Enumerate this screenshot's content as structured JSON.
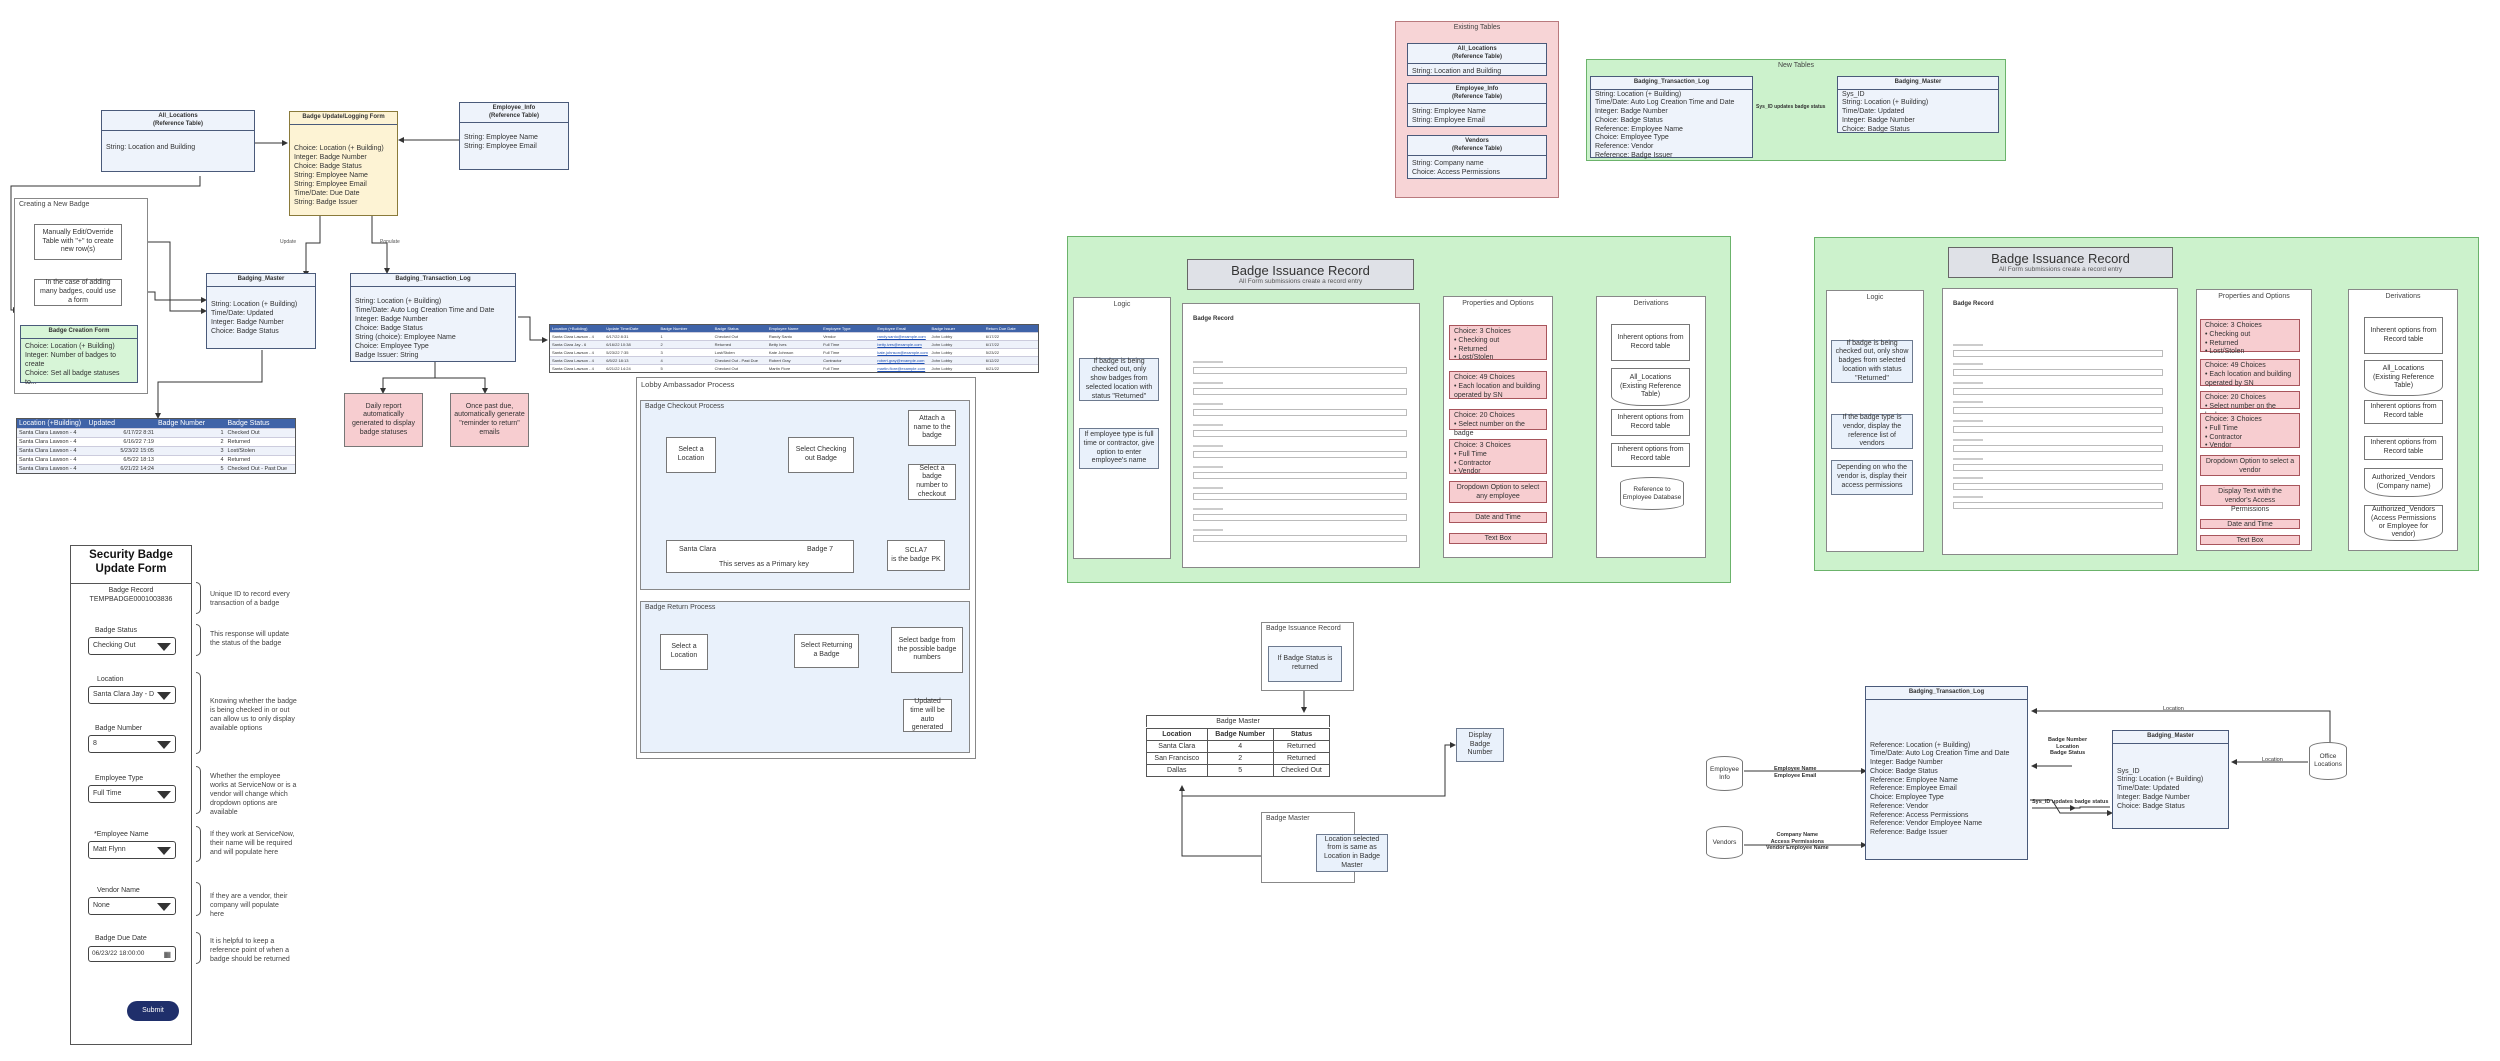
{
  "top_left": {
    "all_locations_title": "All_Locations\n(Reference Table)",
    "all_locations_body": "String: Location and Building",
    "badge_form_title": "Badge Update/Logging Form",
    "badge_form_body": "Choice: Location (+ Building)\nInteger: Badge Number\nChoice: Badge Status\nString: Employee Name\nString: Employee Email\nTime/Date: Due Date\nString: Badge Issuer",
    "employee_info_title": "Employee_Info\n(Reference Table)",
    "employee_info_body": "String: Employee Name\nString: Employee Email",
    "creating_group": "Creating a New Badge",
    "manual_edit": "Manually Edit/Override Table with \"+\" to create new row(s)",
    "case_adding": "In the case of adding many badges, could use a form",
    "creation_form_title": "Badge Creation Form",
    "creation_form_body": "Choice: Location (+ Building)\nInteger: Number of badges to create\nChoice: Set all badge statuses to...",
    "badging_master_title": "Badging_Master",
    "badging_master_body": "String: Location (+ Building)\nTime/Date: Updated\nInteger: Badge Number\nChoice: Badge Status",
    "transaction_log_title": "Badging_Transaction_Log",
    "transaction_log_body": "String: Location (+ Building)\nTime/Date: Auto Log Creation Time and Date\nInteger: Badge Number\nChoice: Badge Status\nString (choice): Employee Name\nChoice: Employee Type\nBadge Issuer: String",
    "edge_update": "Update",
    "edge_populate": "Populate",
    "daily_report": "Daily report automatically generated to display badge statuses",
    "once_past_due": "Once past due, automatically generate \"reminder to return\" emails"
  },
  "master_sheet": {
    "headers": [
      "Location (+Building)",
      "Updated",
      "Badge Number",
      "Badge Status"
    ],
    "rows": [
      [
        "Santa Clara Lawson - 4",
        "6/17/22 8:31",
        "1",
        "Checked Out"
      ],
      [
        "Santa Clara Lawson - 4",
        "6/16/22 7:19",
        "2",
        "Returned"
      ],
      [
        "Santa Clara Lawson - 4",
        "5/23/22 15:05",
        "3",
        "Lost/Stolen"
      ],
      [
        "Santa Clara Lawson - 4",
        "6/5/22 18:13",
        "4",
        "Returned"
      ],
      [
        "Santa Clara Lawson - 4",
        "6/21/22 14:24",
        "5",
        "Checked Out - Past Due"
      ]
    ]
  },
  "log_sheet": {
    "headers": [
      "Location (+Building)",
      "Update Time/Date",
      "Badge Number",
      "Badge Status",
      "Employee Name",
      "Employee Type",
      "Employee Email",
      "Badge Issuer",
      "Return Due Date"
    ],
    "rows": [
      [
        "Santa Clara Lawson - 4",
        "6/17/22 8:31",
        "1",
        "Checked Out",
        "Randy Santo",
        "Vendor",
        "randy.santo@example.com",
        "John Lobby",
        "6/17/22"
      ],
      [
        "Santa Clara Jay - 6",
        "6/16/22 10:38",
        "2",
        "Returned",
        "Betty Ives",
        "Full Time",
        "betty.ives@example.com",
        "John Lobby",
        "6/17/22"
      ],
      [
        "Santa Clara Lawson - 4",
        "5/23/22 7:35",
        "3",
        "Lost/Stolen",
        "Kate Johnson",
        "Full Time",
        "kate.johnson@example.com",
        "John Lobby",
        "5/23/22"
      ],
      [
        "Santa Clara Lawson - 4",
        "6/5/22 18:13",
        "4",
        "Checked Out - Past Due",
        "Robert Gray",
        "Contractor",
        "robert.gray@example.com",
        "John Lobby",
        "6/12/22"
      ],
      [
        "Santa Clara Lawson - 4",
        "6/21/22 14:24",
        "5",
        "Checked Out",
        "Martin Fiore",
        "Full Time",
        "martin.fiore@example.com",
        "John Lobby",
        "6/21/22"
      ]
    ]
  },
  "security_form": {
    "title": "Security Badge\nUpdate Form",
    "badge_record_label": "Badge Record",
    "badge_record_value": "TEMPBADGE0001003836",
    "badge_status_label": "Badge Status",
    "badge_status_value": "Checking Out",
    "location_label": "Location",
    "location_value": "Santa Clara Jay - D",
    "badge_number_label": "Badge Number",
    "badge_number_value": "8",
    "employee_type_label": "Employee Type",
    "employee_type_value": "Full Time",
    "employee_name_label": "*Employee Name",
    "employee_name_value": "Matt Flynn",
    "vendor_name_label": "Vendor Name",
    "vendor_name_value": "None",
    "due_date_label": "Badge Due Date",
    "due_date_value": "06/23/22 18:00:00",
    "submit_label": "Submit",
    "notes": [
      "Unique ID to record every transaction of a badge",
      "This response will update the status of the badge",
      "Knowing whether the badge is being checked in or out can allow us to only display available options",
      "Whether the employee works at ServiceNow or is a vendor will change which dropdown options are available",
      "If they work at ServiceNow, their name will be required and will populate here",
      "If they are a vendor, their company will populate here",
      "It is helpful to keep a reference point of when a badge should be returned"
    ]
  },
  "lobby": {
    "title": "Lobby Ambassador Process",
    "checkout_title": "Badge Checkout Process",
    "select_location": "Select a Location",
    "select_checking_out": "Select Checking out Badge",
    "attach_name": "Attach a name to the badge",
    "select_badge_number": "Select a badge number to checkout",
    "santa_clara": "Santa Clara",
    "badge7": "Badge 7",
    "primary_key": "This serves as a Primary key",
    "sclа7": "SCLA7\nis the badge PK",
    "return_title": "Badge Return Process",
    "select_returning": "Select Returning a Badge",
    "select_badge_possible": "Select badge from the possible badge numbers",
    "updated_time": "Updated time will be auto generated"
  },
  "existing_tables": {
    "title": "Existing Tables",
    "all_loc_title": "All_Locations\n(Reference Table)",
    "all_loc_body": "String: Location and Building",
    "emp_title": "Employee_Info\n(Reference Table)",
    "emp_body": "String: Employee Name\nString: Employee Email",
    "vendors_title": "Vendors\n(Reference Table)",
    "vendors_body": "String: Company name\nChoice: Access Permissions"
  },
  "new_tables": {
    "title": "New Tables",
    "log_title": "Badging_Transaction_Log",
    "log_body": "String: Location (+ Building)\nTime/Date: Auto Log Creation Time and Date\nInteger: Badge Number\nChoice: Badge Status\nReference: Employee Name\nChoice: Employee Type\nReference: Vendor\nReference: Badge Issuer",
    "edge": "Sys_ID updates badge status",
    "master_title": "Badging_Master",
    "master_body": "Sys_ID\nString: Location (+ Building)\nTime/Date: Updated\nInteger: Badge Number\nChoice: Badge Status"
  },
  "bir_left": {
    "title": "Badge Issuance Record",
    "subtitle": "All Form submissions create a record entry",
    "logic": "Logic",
    "props": "Properties and Options",
    "derivs": "Derivations",
    "form_title": "Badge Record",
    "logic_items": [
      "If badge is being checked out, only show badges from selected location with status \"Returned\"",
      "If employee type is full time or contractor, give option to enter employee's name"
    ],
    "props_items": [
      "Choice: 3 Choices\n• Checking out\n• Returned\n• Lost/Stolen",
      "Choice: 49 Choices\n• Each location and building operated by SN",
      "Choice: 20 Choices\n• Select number on the badge",
      "Choice: 3 Choices\n• Full Time\n• Contractor\n• Vendor",
      "Dropdown Option to select any employee",
      "Date and Time",
      "Text Box"
    ],
    "derivs_items": [
      "Inherent options from Record table",
      "All_Locations\n(Existing Reference Table)",
      "Inherent options from Record table",
      "Inherent options from Record table",
      "Reference to Employee Database"
    ]
  },
  "bir_right": {
    "title": "Badge Issuance Record",
    "subtitle": "All Form submissions create a record entry",
    "logic": "Logic",
    "props": "Properties and Options",
    "derivs": "Derivations",
    "form_title": "Badge Record",
    "logic_items": [
      "If badge is being checked out, only show badges from selected location with status \"Returned\"",
      "If the badge type is vendor, display the reference list of vendors",
      "Depending on who the vendor is, display their access permissions"
    ],
    "props_items": [
      "Choice: 3 Choices\n• Checking out\n• Returned\n• Lost/Stolen",
      "Choice: 49 Choices\n• Each location and building operated by SN",
      "Choice: 20 Choices\n• Select number on the badge",
      "Choice: 3 Choices\n• Full Time\n• Contractor\n• Vendor",
      "Dropdown Option to select a vendor",
      "Display Text with the vendor's Access Permissions",
      "Date and Time",
      "Text Box"
    ],
    "derivs_items": [
      "Inherent options from Record table",
      "All_Locations\n(Existing Reference Table)",
      "Inherent options from Record table",
      "Inherent options from Record table",
      "Authorized_Vendors\n(Company name)",
      "Authorized_Vendors\n(Access Permissions or Employee for vendor)"
    ]
  },
  "bottom_center": {
    "issuance_group": "Badge Issuance Record",
    "if_returned": "If Badge Status is returned",
    "table_title": "Badge Master",
    "headers": [
      "Location",
      "Badge Number",
      "Status"
    ],
    "rows": [
      [
        "Santa Clara",
        "4",
        "Returned"
      ],
      [
        "San Francisco",
        "2",
        "Returned"
      ],
      [
        "Dallas",
        "5",
        "Checked Out"
      ]
    ],
    "display_badge": "Display Badge Number",
    "master_group": "Badge Master",
    "location_selected": "Location selected from  is same as Location in Badge Master"
  },
  "bottom_right": {
    "log_title": "Badging_Transaction_Log",
    "log_body": "Reference: Location (+ Building)\nTime/Date: Auto Log Creation Time and Date\nInteger: Badge Number\nChoice: Badge Status\nReference: Employee Name\nReference: Employee Email\nChoice: Employee Type\nReference: Vendor\nReference: Access Permissions\nReference: Vendor Employee Name\nReference: Badge Issuer",
    "master_title": "Badging_Master",
    "master_body": "Sys_ID\nString: Location (+ Building)\nTime/Date: Updated\nInteger: Badge Number\nChoice: Badge Status",
    "emp_info": "Employee Info",
    "vendors": "Vendors",
    "office_locations": "Office Locations",
    "edge_emp": "Employee Name\nEmployee Email",
    "edge_vendor": "Company Name\nAccess Permissions\nVendor Employee Name",
    "edge_sys": "Sys_ID updates badge status",
    "edge_badge": "Badge Number\nLocation\nBadge Status",
    "edge_loc1": "Location",
    "edge_loc2": "Location"
  }
}
